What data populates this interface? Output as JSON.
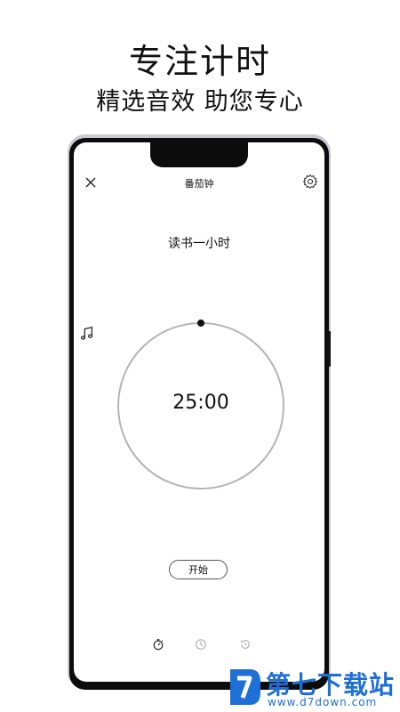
{
  "promo": {
    "title": "专注计时",
    "subtitle": "精选音效 助您专心"
  },
  "app": {
    "screen_title": "番茄钟",
    "task_name": "读书一小时",
    "timer": {
      "display": "25:00",
      "progress": 0
    },
    "start_label": "开始",
    "icons": {
      "close": "close-icon",
      "settings": "gear-icon",
      "music": "music-note-icon"
    },
    "bottom_nav": [
      {
        "icon": "stopwatch-icon",
        "active": true
      },
      {
        "icon": "clock-icon",
        "active": false
      },
      {
        "icon": "history-clock-icon",
        "active": false
      }
    ]
  },
  "watermark": {
    "brand": "第七下载站",
    "url": "www.d7down.com"
  },
  "colors": {
    "watermark": "#1e6fd6",
    "ring": "#b5b5b5",
    "text": "#111111"
  }
}
